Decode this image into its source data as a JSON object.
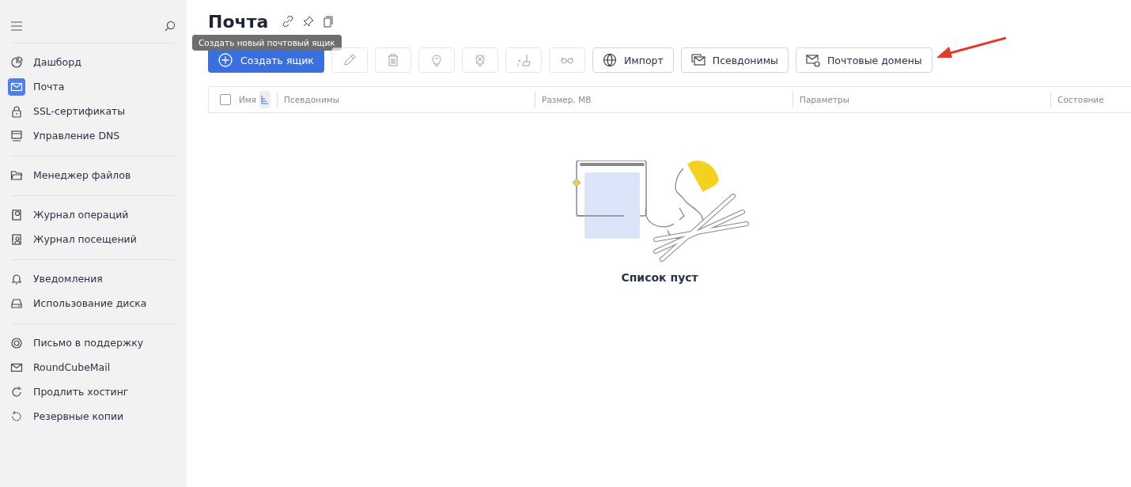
{
  "sidebar": {
    "groups": [
      {
        "items": [
          {
            "label": "Дашборд",
            "selected": false
          },
          {
            "label": "Почта",
            "selected": true
          },
          {
            "label": "SSL-сертификаты",
            "selected": false
          },
          {
            "label": "Управление DNS",
            "selected": false
          }
        ]
      },
      {
        "items": [
          {
            "label": "Менеджер файлов",
            "selected": false
          }
        ]
      },
      {
        "items": [
          {
            "label": "Журнал операций",
            "selected": false
          },
          {
            "label": "Журнал посещений",
            "selected": false
          }
        ]
      },
      {
        "items": [
          {
            "label": "Уведомления",
            "selected": false
          },
          {
            "label": "Использование диска",
            "selected": false
          }
        ]
      },
      {
        "items": [
          {
            "label": "Письмо в поддержку",
            "selected": false
          },
          {
            "label": "RoundCubeMail",
            "selected": false
          },
          {
            "label": "Продлить хостинг",
            "selected": false
          },
          {
            "label": "Резервные копии",
            "selected": false
          }
        ]
      }
    ]
  },
  "page": {
    "title": "Почта",
    "tooltip": "Создать новый почтовый ящик"
  },
  "toolbar": {
    "primary": {
      "label": "Создать ящик"
    },
    "icon_buttons": [
      {
        "disabled": true
      },
      {
        "disabled": true
      },
      {
        "disabled": true
      },
      {
        "disabled": true
      },
      {
        "disabled": true
      },
      {
        "disabled": true
      }
    ],
    "buttons": [
      {
        "label": "Импорт"
      },
      {
        "label": "Псевдонимы"
      },
      {
        "label": "Почтовые домены"
      }
    ]
  },
  "table": {
    "checked": false,
    "columns": [
      "Имя",
      "Псевдонимы",
      "Размер, MB",
      "Параметры",
      "Состояние"
    ]
  },
  "empty": {
    "text": "Список пуст"
  }
}
